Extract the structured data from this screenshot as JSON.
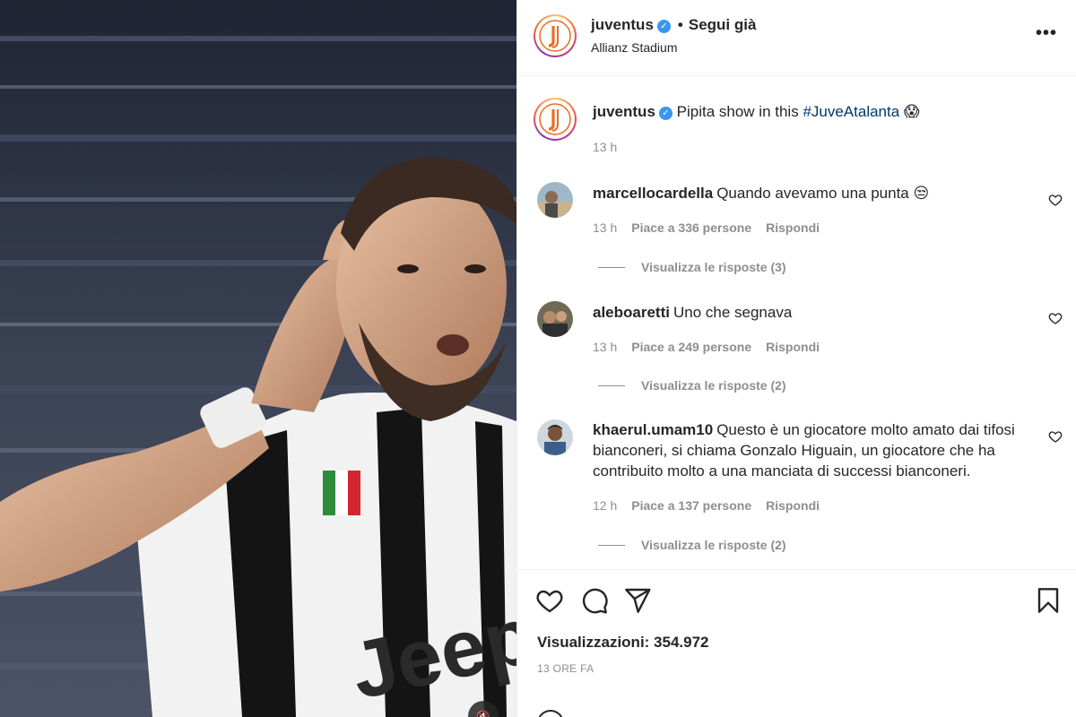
{
  "post": {
    "account": "juventus",
    "follow_status": "Segui già",
    "separator": "•",
    "location": "Allianz Stadium",
    "more_label": "•••",
    "logo_letter": "J"
  },
  "caption": {
    "username": "juventus",
    "text_prefix": "Pipita show in this ",
    "hashtag": "#JuveAtalanta",
    "emoji": "😱",
    "time": "13 h"
  },
  "comments": [
    {
      "username": "marcellocardella",
      "text": "Quando avevamo una punta 😒",
      "time": "13 h",
      "likes": "Piace a 336 persone",
      "reply": "Rispondi",
      "view_replies": "Visualizza le risposte (3)"
    },
    {
      "username": "aleboaretti",
      "text": "Uno che segnava",
      "time": "13 h",
      "likes": "Piace a 249 persone",
      "reply": "Rispondi",
      "view_replies": "Visualizza le risposte (2)"
    },
    {
      "username": "khaerul.umam10",
      "text": "Questo è un giocatore molto amato dai tifosi bianconeri, si chiama Gonzalo Higuain, un giocatore che ha contribuito molto a una manciata di successi bianconeri.",
      "time": "12 h",
      "likes": "Piace a 137 persone",
      "reply": "Rispondi",
      "view_replies": "Visualizza le risposte (2)"
    }
  ],
  "stats": {
    "views": "Visualizzazioni: 354.972",
    "posted": "13 ORE FA"
  },
  "media": {
    "mute_icon": "🔇",
    "jersey_text": "Jeep"
  },
  "colors": {
    "link": "#00376b",
    "verified": "#3897f0",
    "secondary_text": "#8e8e8e",
    "juve_orange": "#e86d1f"
  }
}
